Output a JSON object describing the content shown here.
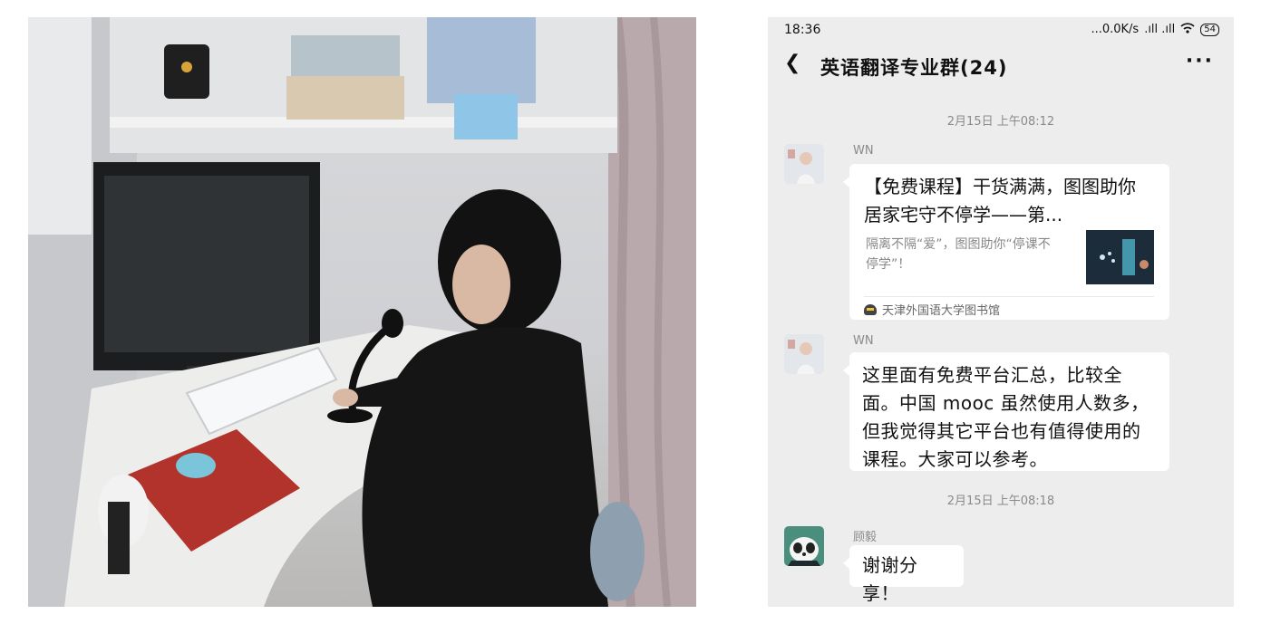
{
  "status_bar": {
    "time": "18:36",
    "network": "...0.0K/s",
    "signal_icons": ".ıll .ıll",
    "wifi": "wifi-icon",
    "battery": "54"
  },
  "chat": {
    "back_icon": "back-arrow-icon",
    "title": "英语翻译专业群(24)",
    "more_icon": "more-icon",
    "more_label": "···"
  },
  "messages": [
    {
      "time": "2月15日 上午08:12",
      "sender": "WN",
      "type": "link-card",
      "card_title": "【免费课程】干货满满，图图助你居家宅守不停学——第...",
      "card_desc": "隔离不隔“爱”，图图助你“停课不停学”！",
      "card_source": "天津外国语大学图书馆"
    },
    {
      "sender": "WN",
      "type": "text",
      "text": "这里面有免费平台汇总，比较全面。中国 mooc 虽然使用人数多，但我觉得其它平台也有值得使用的课程。大家可以参考。"
    },
    {
      "time": "2月15日 上午08:18",
      "sender": "顾毅",
      "type": "text",
      "text": "谢谢分享！"
    }
  ],
  "colors": {
    "chat_background": "#ededed",
    "bubble": "#ffffff",
    "meta_text": "#8a8a8a"
  }
}
